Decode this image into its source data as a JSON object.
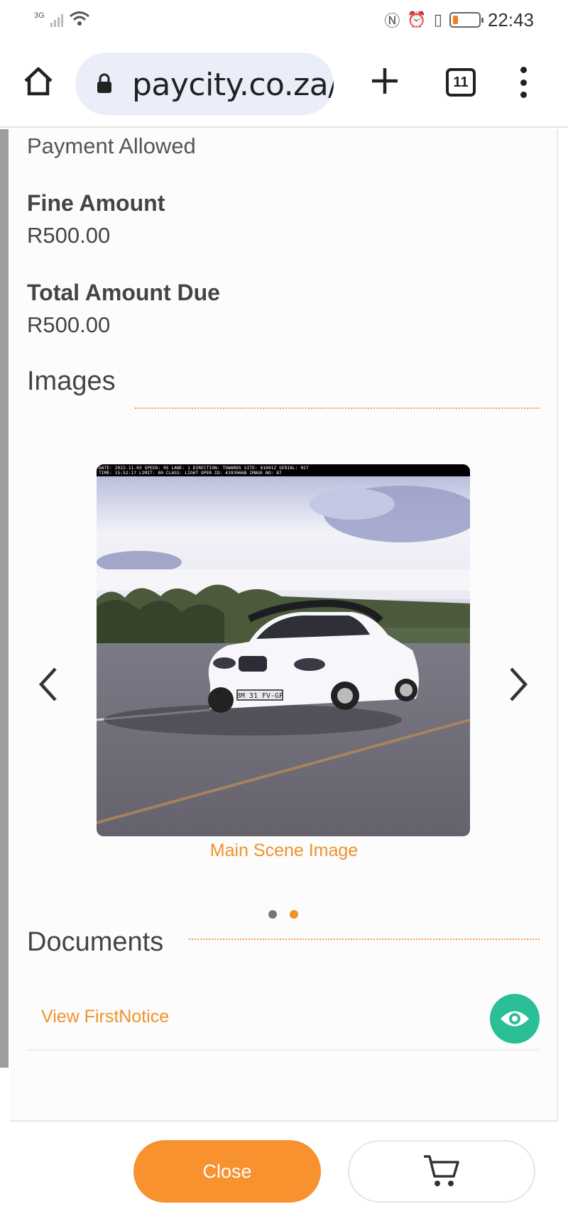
{
  "status_bar": {
    "network": "3G",
    "time": "22:43",
    "battery_level": 0.2,
    "battery_color": "#f47e20"
  },
  "browser": {
    "url": "paycity.co.za/",
    "tab_count": "11",
    "icons": [
      "home-icon",
      "lock-icon",
      "new-tab-icon",
      "tabs-icon",
      "more-menu-icon"
    ]
  },
  "fine": {
    "payment_status": "Payment Allowed",
    "fine_amount_label": "Fine Amount",
    "fine_amount": "R500.00",
    "total_due_label": "Total Amount Due",
    "total_due": "R500.00"
  },
  "images": {
    "title": "Images",
    "overlay_line1": "DATE: 2022-11-03  SPEED: 95  LANE: 1      DIRECTION: TOWARDS SITE: 01001Z  SERIAL: 027",
    "overlay_line2": "TIME: 15:52:17     LIMIT: 80  CLASS: LIGHT OPER ID: 4393066B  IMAGE NO: 87",
    "plate": "BM 31 FV-GP",
    "caption": "Main Scene Image",
    "current_slide": 2,
    "total_slides": 2,
    "accent_color": "#f0922b"
  },
  "documents": {
    "title": "Documents",
    "link_label": "View FirstNotice",
    "view_button_color": "#2bbf98"
  },
  "footer": {
    "close_label": "Close",
    "cart_icon": "cart-icon",
    "brand_color": "#f7922f"
  }
}
